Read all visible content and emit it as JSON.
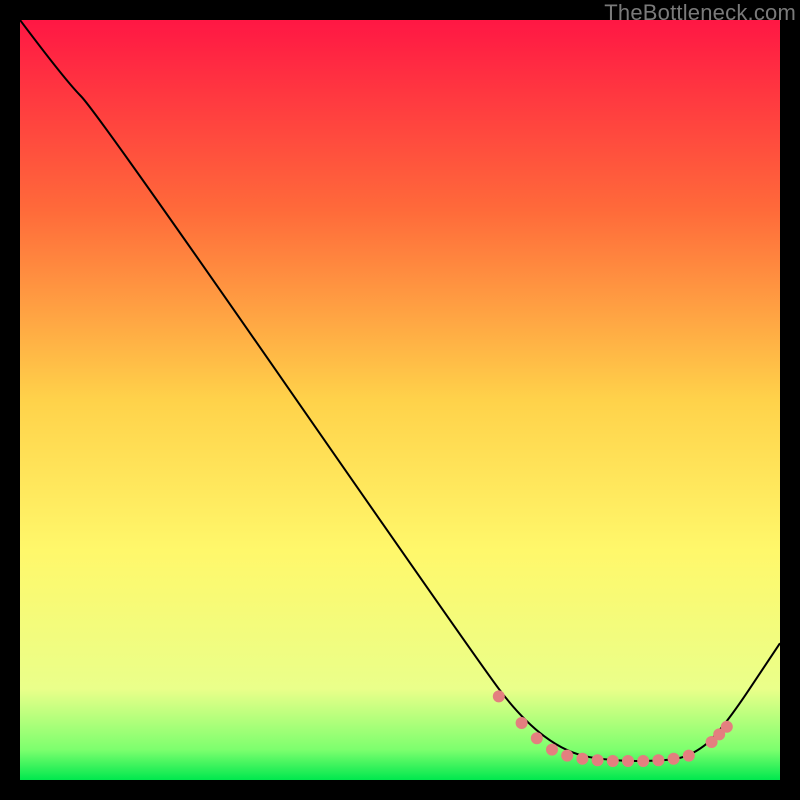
{
  "watermark": "TheBottleneck.com",
  "chart_data": {
    "type": "line",
    "xlim": [
      0,
      100
    ],
    "ylim": [
      0,
      100
    ],
    "background_gradient": {
      "stops": [
        {
          "offset": 0,
          "color": "#ff1744"
        },
        {
          "offset": 25,
          "color": "#ff6a3a"
        },
        {
          "offset": 50,
          "color": "#ffd24a"
        },
        {
          "offset": 70,
          "color": "#fff86b"
        },
        {
          "offset": 88,
          "color": "#eaff8a"
        },
        {
          "offset": 96,
          "color": "#7dff6e"
        },
        {
          "offset": 100,
          "color": "#00e84e"
        }
      ]
    },
    "series": [
      {
        "name": "curve",
        "color": "#000000",
        "width": 2,
        "points": [
          {
            "x": 0,
            "y": 100
          },
          {
            "x": 6,
            "y": 92
          },
          {
            "x": 10,
            "y": 88
          },
          {
            "x": 60,
            "y": 16
          },
          {
            "x": 66,
            "y": 8
          },
          {
            "x": 72,
            "y": 3.5
          },
          {
            "x": 78,
            "y": 2.5
          },
          {
            "x": 84,
            "y": 2.5
          },
          {
            "x": 88,
            "y": 3
          },
          {
            "x": 92,
            "y": 6
          },
          {
            "x": 100,
            "y": 18
          }
        ]
      }
    ],
    "markers": {
      "color": "#e37f7f",
      "radius": 6,
      "points": [
        {
          "x": 63,
          "y": 11
        },
        {
          "x": 66,
          "y": 7.5
        },
        {
          "x": 68,
          "y": 5.5
        },
        {
          "x": 70,
          "y": 4
        },
        {
          "x": 72,
          "y": 3.2
        },
        {
          "x": 74,
          "y": 2.8
        },
        {
          "x": 76,
          "y": 2.6
        },
        {
          "x": 78,
          "y": 2.5
        },
        {
          "x": 80,
          "y": 2.5
        },
        {
          "x": 82,
          "y": 2.5
        },
        {
          "x": 84,
          "y": 2.6
        },
        {
          "x": 86,
          "y": 2.8
        },
        {
          "x": 88,
          "y": 3.2
        },
        {
          "x": 91,
          "y": 5
        },
        {
          "x": 92,
          "y": 6
        },
        {
          "x": 93,
          "y": 7
        }
      ]
    }
  }
}
